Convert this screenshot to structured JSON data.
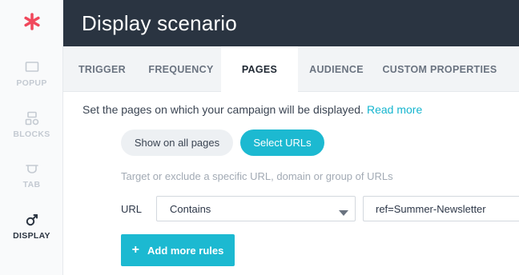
{
  "sidebar": {
    "logo_icon": "asterisk-logo-icon",
    "brand_color": "#f0485c",
    "items": [
      {
        "label": "POPUP",
        "icon": "popup-icon",
        "active": false
      },
      {
        "label": "BLOCKS",
        "icon": "blocks-icon",
        "active": false
      },
      {
        "label": "TAB",
        "icon": "tab-icon",
        "active": false
      },
      {
        "label": "DISPLAY",
        "icon": "display-icon",
        "active": true
      }
    ]
  },
  "header": {
    "title": "Display scenario"
  },
  "tabs": [
    {
      "label": "TRIGGER",
      "active": false
    },
    {
      "label": "FREQUENCY",
      "active": false
    },
    {
      "label": "PAGES",
      "active": true
    },
    {
      "label": "AUDIENCE",
      "active": false
    },
    {
      "label": "CUSTOM PROPERTIES",
      "active": false
    }
  ],
  "pages": {
    "description": "Set the pages on which your campaign will be displayed.",
    "read_more": "Read more",
    "toggle": {
      "all_pages": "Show on all pages",
      "select_urls": "Select URLs",
      "selected": "select_urls"
    },
    "hint": "Target or exclude a specific URL, domain or group of URLs",
    "rule": {
      "label": "URL",
      "operator": "Contains",
      "value": "ref=Summer-Newsletter"
    },
    "add_rules": "Add more rules"
  },
  "colors": {
    "accent": "#1cb9d1",
    "header_bg": "#2a3441",
    "tab_bar_bg": "#f2f4f6"
  }
}
